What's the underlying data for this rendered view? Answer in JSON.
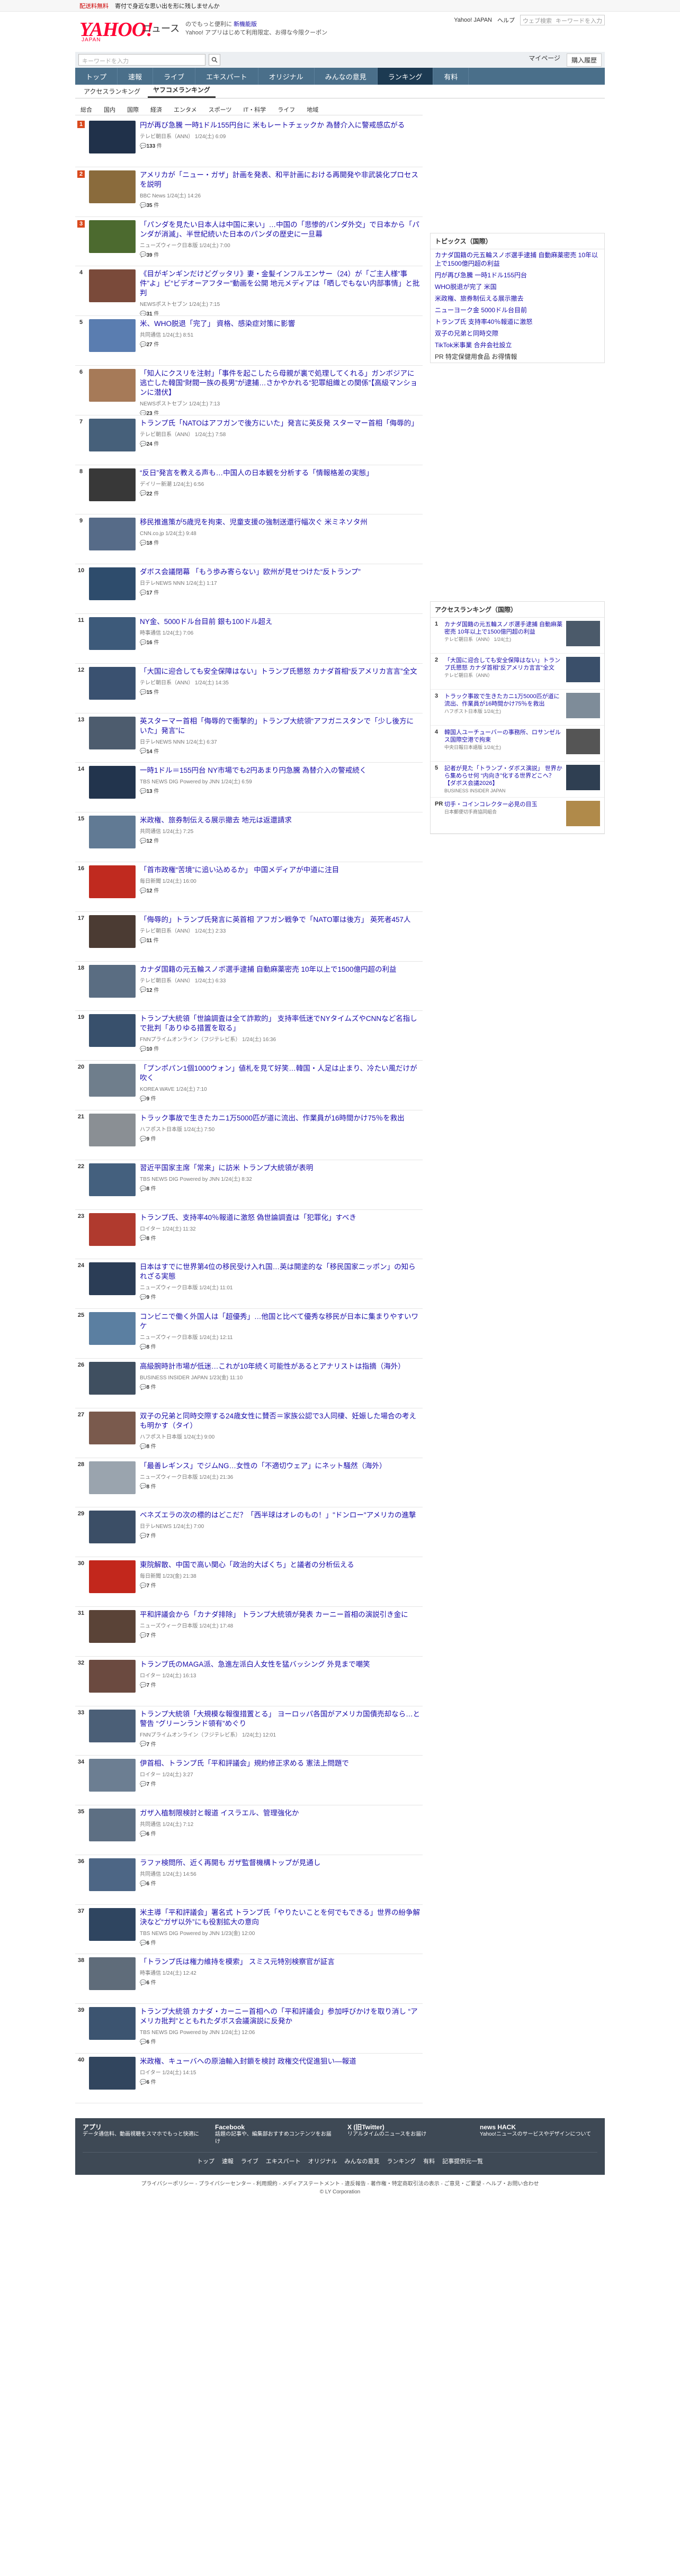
{
  "topbar": {
    "left": "配送料無料",
    "mid": "寄付で身近な思い出を形に残しませんか",
    "right": ""
  },
  "header": {
    "logo": "YAHOO!",
    "logo_sub": "JAPAN",
    "service": "ニュース",
    "tag1": "のでもっと便利に",
    "tag1b": "新機能版",
    "tag2": "Yahoo! アプリはじめて利用限定、お得な今限クーポン",
    "links": [
      "Yahoo! JAPAN",
      "ヘルプ"
    ],
    "search_placeholder": "ウェブ検索",
    "search_tag": "キーワードを入力"
  },
  "searchrow": {
    "placeholder": "キーワードを入力",
    "mypage": "マイページ",
    "buy": "購入履歴"
  },
  "gnav": [
    "トップ",
    "速報",
    "ライブ",
    "エキスパート",
    "オリジナル",
    "みんなの意見",
    "ランキング",
    "有料"
  ],
  "subtabs": [
    "アクセスランキング",
    "ヤフコメランキング"
  ],
  "cats": [
    "総合",
    "国内",
    "国際",
    "経済",
    "エンタメ",
    "スポーツ",
    "IT・科学",
    "ライフ",
    "地域"
  ],
  "items": [
    {
      "rank": "1",
      "title": "円が再び急騰 一時1ドル155円台に 米もレートチェックか 為替介入に警戒感広がる",
      "src": "テレビ朝日系（ANN） 1/24(土) 6:09",
      "cmt": "133",
      "color": "#20314a"
    },
    {
      "rank": "2",
      "title": "アメリカが「ニュー・ガザ」計画を発表、和平計画における再開発や非武装化プロセスを説明",
      "src": "BBC News 1/24(土) 14:26",
      "cmt": "35",
      "color": "#8a6b3c"
    },
    {
      "rank": "3",
      "title": "「パンダを見たい日本人は中国に来い」…中国の「悲惨的パンダ外交」で日本から「パンダが消滅」、半世紀続いた日本のパンダの歴史に一旦幕",
      "src": "ニューズウィーク日本版 1/24(土) 7:00",
      "cmt": "39",
      "color": "#4c6a2f"
    },
    {
      "rank": "4",
      "title": "《目がギンギンだけどグッタリ》妻・金髪インフルエンサー（24）が「ご主人様”事件”よ」ビ“ビデオーアフター”動画を公開 地元メディアは「晒しでもない内部事情」と批判",
      "src": "NEWSポストセブン 1/24(土) 7:15",
      "cmt": "31",
      "color": "#7a4a3a"
    },
    {
      "rank": "5",
      "title": "米、WHO脱退「完了」 資格、感染症対策に影響",
      "src": "共同通信 1/24(土) 8:51",
      "cmt": "27",
      "color": "#5a7db0"
    },
    {
      "rank": "6",
      "title": "「知人にクスリを注射」「事件を起こしたら母親が裏で処理してくれる」ガンボジアに逃亡した韓国“財閥一族の長男”が逮捕…さかやかれる“犯罪組織との関係”【高級マンションに潜伏】",
      "src": "NEWSポストセブン 1/24(土) 7:13",
      "cmt": "23",
      "color": "#a67a58"
    },
    {
      "rank": "7",
      "title": "トランプ氏「NATOはアフガンで後方にいた」発言に英反発 スターマー首相「侮辱的」",
      "src": "テレビ朝日系（ANN） 1/24(土) 7:58",
      "cmt": "24",
      "color": "#46607a"
    },
    {
      "rank": "8",
      "title": "“反日”発言を教える声も…中国人の日本観を分析する「情報格差の実態」",
      "src": "デイリー新潮 1/24(土) 6:56",
      "cmt": "22",
      "color": "#383838"
    },
    {
      "rank": "9",
      "title": "移民推進策が5歳児を拘束、児童支援の強制送還行幅次ぐ 米ミネソタ州",
      "src": "CNN.co.jp 1/24(土) 9:48",
      "cmt": "18",
      "color": "#566b88"
    },
    {
      "rank": "10",
      "title": "ダボス会議閉幕 「もう歩み寄らない」欧州が見せつけた“反トランプ”",
      "src": "日テレNEWS NNN 1/24(土) 1:17",
      "cmt": "17",
      "color": "#2e4c6c"
    },
    {
      "rank": "11",
      "title": "NY金、5000ドル台目前 銀も100ドル超え",
      "src": "時事通信 1/24(土) 7:06",
      "cmt": "16",
      "color": "#3d5a7a"
    },
    {
      "rank": "12",
      "title": "「大国に迎合しても安全保障はない」トランプ氏懇怒 カナダ首相“反アメリカ言言”全文",
      "src": "テレビ朝日系（ANN） 1/24(土) 14:35",
      "cmt": "15",
      "color": "#3a5170"
    },
    {
      "rank": "13",
      "title": "英スターマー首相「侮辱的で衝撃的」トランプ大統領“アフガニスタンで「少し後方にいた」発言”に",
      "src": "日テレNEWS NNN 1/24(土) 6:37",
      "cmt": "14",
      "color": "#4d5c6e"
    },
    {
      "rank": "14",
      "title": "一時1ドル＝155円台 NY市場でも2円あまり円急騰 為替介入の警戒続く",
      "src": "TBS NEWS DIG Powered by JNN 1/24(土) 6:59",
      "cmt": "13",
      "color": "#22344d"
    },
    {
      "rank": "15",
      "title": "米政権、旅券制伝える展示撤去 地元は返還請求",
      "src": "共同通信 1/24(土) 7:25",
      "cmt": "12",
      "color": "#617a94"
    },
    {
      "rank": "16",
      "title": "「首市政権“苦境”に追い込めるか」 中国メディアが中道に注目",
      "src": "毎日新聞 1/24(土) 16:00",
      "cmt": "12",
      "color": "#c02a1f"
    },
    {
      "rank": "17",
      "title": "「侮辱的」トランプ氏発言に英首相 アフガン戦争で「NATO軍は後方」 英死者457人",
      "src": "テレビ朝日系（ANN） 1/24(土) 2:33",
      "cmt": "11",
      "color": "#4b3b33"
    },
    {
      "rank": "18",
      "title": "カナダ国籍の元五輪スノボ選手逮捕 自動麻薬密売 10年以上で1500億円超の利益",
      "src": "テレビ朝日系（ANN） 1/24(土) 6:33",
      "cmt": "12",
      "color": "#5a6d82"
    },
    {
      "rank": "19",
      "title": "トランプ大統領「世論調査は全て詐欺的」 支持率低迷でNYタイムズやCNNなど名指しで批判「ありゆる措置を取る」",
      "src": "FNNプライムオンライン（フジテレビ系） 1/24(土) 16:36",
      "cmt": "10",
      "color": "#38506c"
    },
    {
      "rank": "20",
      "title": "「プンポパン1個1000ウォン」値札を見て好笑…韓国・人足は止まり、冷たい風だけが吹く",
      "src": "KOREA WAVE 1/24(土) 7:10",
      "cmt": "9",
      "color": "#6f7e8c"
    },
    {
      "rank": "21",
      "title": "トラック事故で生きたカニ1万5000匹が道に流出、作業員が16時間かけ75％を救出",
      "src": "ハフポスト日本版 1/24(土) 7:50",
      "cmt": "9",
      "color": "#8a8f94"
    },
    {
      "rank": "22",
      "title": "習近平国家主席「常来」に訪米 トランプ大統領が表明",
      "src": "TBS NEWS DIG Powered by JNN 1/24(土) 8:32",
      "cmt": "8",
      "color": "#44607e"
    },
    {
      "rank": "23",
      "title": "トランプ氏、支持率40％報道に激怒 偽世論調査は「犯罪化」すべき",
      "src": "ロイター 1/24(土) 11:32",
      "cmt": "8",
      "color": "#b03a2e"
    },
    {
      "rank": "24",
      "title": "日本はすでに世界第4位の移民受け入れ国…英は開塗的な「移民国家ニッポン」の知られざる実態",
      "src": "ニューズウィーク日本版 1/24(土) 11:01",
      "cmt": "9",
      "color": "#2b3d56"
    },
    {
      "rank": "25",
      "title": "コンビニで働く外国人は「超優秀」…他国と比べて優秀な移民が日本に集まりやすいワケ",
      "src": "ニューズウィーク日本版 1/24(土) 12:11",
      "cmt": "8",
      "color": "#5b7fa1"
    },
    {
      "rank": "26",
      "title": "高級腕時計市場が低迷…これが10年続く可能性があるとアナリストは指摘（海外）",
      "src": "BUSINESS INSIDER JAPAN 1/23(金) 11:10",
      "cmt": "8",
      "color": "#3f4f60"
    },
    {
      "rank": "27",
      "title": "双子の兄弟と同時交際する24歳女性に賛否＝家族公認で3人同棲、妊娠した場合の考えも明かす（タイ）",
      "src": "ハフポスト日本版 1/24(土) 9:00",
      "cmt": "8",
      "color": "#7a5a4d"
    },
    {
      "rank": "28",
      "title": "「最善レギンス」でジムNG…女性の「不適切ウェア」にネット騒然（海外）",
      "src": "ニューズウィーク日本版 1/24(土) 21:36",
      "cmt": "8",
      "color": "#9aa4ae"
    },
    {
      "rank": "29",
      "title": "ベネズエラの次の標的はどこだ？「西半球はオレのもの！」\"ドンロー\"アメリカの進撃",
      "src": "日テレNEWS 1/24(土) 7:00",
      "cmt": "7",
      "color": "#3b4e66"
    },
    {
      "rank": "30",
      "title": "東院解散、中国で高い関心「政治的大ばくち」と議者の分析伝える",
      "src": "毎日新聞 1/23(金) 21:38",
      "cmt": "7",
      "color": "#c2271c"
    },
    {
      "rank": "31",
      "title": "平和評議会から「カナダ排除」 トランプ大統領が発表 カーニー首相の演説引き金に",
      "src": "ニューズウィーク日本版 1/24(土) 17:48",
      "cmt": "7",
      "color": "#5a4337"
    },
    {
      "rank": "32",
      "title": "トランプ氏のMAGA派、急進左派白人女性を猛バッシング 外見まで嘲笑",
      "src": "ロイター 1/24(土) 16:13",
      "cmt": "7",
      "color": "#6b4a40"
    },
    {
      "rank": "33",
      "title": "トランプ大統領「大規模な報復措置とる」 ヨーロッパ各国がアメリカ国債売却なら…と警告 “グリーンランド領有”めぐり",
      "src": "FNNプライムオンライン（フジテレビ系） 1/24(土) 12:01",
      "cmt": "7",
      "color": "#4b5f77"
    },
    {
      "rank": "34",
      "title": "伊首相、トランプ氏「平和評議会」規約修正求める 憲法上問題で",
      "src": "ロイター 1/24(土) 3:27",
      "cmt": "7",
      "color": "#6c7e92"
    },
    {
      "rank": "35",
      "title": "ガザ入植制限検討と報道 イスラエル、管理強化か",
      "src": "共同通信 1/24(土) 7:12",
      "cmt": "6",
      "color": "#5d6f83"
    },
    {
      "rank": "36",
      "title": "ラファ検問所、近く再開も ガザ監督機構トップが見通し",
      "src": "共同通信 1/24(土) 14:56",
      "cmt": "6",
      "color": "#4d6685"
    },
    {
      "rank": "37",
      "title": "米主導「平和評議会」署名式 トランプ氏「やりたいことを何でもできる」世界の紛争解決など“ガザ以外”にも役割拡大の意向",
      "src": "TBS NEWS DIG Powered by JNN 1/23(金) 12:00",
      "cmt": "6",
      "color": "#2f4560"
    },
    {
      "rank": "38",
      "title": "「トランプ氏は権力維持を模索」 スミス元特別検察官が証言",
      "src": "時事通信 1/24(土) 12:42",
      "cmt": "6",
      "color": "#5f6c7a"
    },
    {
      "rank": "39",
      "title": "トランプ大統領 カナダ・カーニー首相への「平和評議会」参加呼びかけを取り消し “アメリカ批判”とともれたダボス会議演説に反発か",
      "src": "TBS NEWS DIG Powered by JNN 1/24(土) 12:06",
      "cmt": "6",
      "color": "#3c5470"
    },
    {
      "rank": "40",
      "title": "米政権、キューバへの原油輸入封鎖を検討 政権交代促進狙い―報道",
      "src": "ロイター 1/24(土) 14:15",
      "cmt": "6",
      "color": "#31455e"
    }
  ],
  "topics": {
    "heading": "トピックス（国際）",
    "items": [
      "カナダ国籍の元五輪スノボ選手逮捕 自動麻薬密売 10年以上で1500億円超の利益",
      "円が再び急騰 一時1ドル155円台",
      "WHO脱退が完了 米国",
      "米政権、旅券制伝える展示撤去",
      "ニューヨーク金 5000ドル台目前",
      "トランプ氏 支持率40％報道に激怒",
      "双子の兄弟と同時交際",
      "TikTok米事業 合弁会社設立"
    ],
    "pr": "PR 特定保健用食品 お得情報"
  },
  "access": {
    "heading": "アクセスランキング（国際）",
    "items": [
      {
        "n": "1",
        "t": "カナダ国籍の元五輪スノボ選手逮捕 自動麻薬密売 10年以上で1500億円超の利益",
        "s": "テレビ朝日系（ANN） 1/24(土)",
        "color": "#4b5a6a"
      },
      {
        "n": "2",
        "t": "「大国に迎合しても安全保障はない」トランプ氏懇怒 カナダ首相“反アメリカ言言”全文",
        "s": "テレビ朝日系（ANN）",
        "color": "#3a4f6a"
      },
      {
        "n": "3",
        "t": "トラック事故で生きたカニ1万5000匹が道に流出、作業員が16時間かけ75％を救出",
        "s": "ハフポスト日本版 1/24(土)",
        "color": "#7e8c99"
      },
      {
        "n": "4",
        "t": "韓国人ユーチューバーの事務所、ロサンゼルス国際空港で拘束",
        "s": "中央日報日本語版 1/24(土)",
        "color": "#555"
      },
      {
        "n": "5",
        "t": "記者が見た「トランプ・ダボス演説」 世界から集めらせ何 “内向き”化する世界どこへ？【ダボス会議2026】",
        "s": "BUSINESS INSIDER JAPAN",
        "color": "#2f3f52"
      },
      {
        "n": "PR",
        "t": "切手・コインコレクター必見の目玉",
        "s": "日本郵便切手商協同組合",
        "color": "#b08a4a"
      }
    ]
  },
  "footer": {
    "apps": [
      {
        "t": "アプリ",
        "d": "データ通信料、動画視聴をスマホでもっと快適に"
      },
      {
        "t": "Facebook",
        "d": "話題の記事や、編集部おすすめコンテンツをお届け"
      },
      {
        "t": "X (旧Twitter)",
        "d": "リアルタイムのニュースをお届け"
      },
      {
        "t": "news HACK",
        "d": "Yahoo!ニュースのサービスやデザインについて"
      }
    ],
    "links": [
      "トップ",
      "速報",
      "ライブ",
      "エキスパート",
      "オリジナル",
      "みんなの意見",
      "ランキング",
      "有料",
      "記事提供元一覧"
    ],
    "bottom": "プライバシーポリシー - プライバシーセンター - 利用規約 - メディアステートメント - 違反報告 - 著作権・特定商取引法の表示 - ご意見・ご要望 - ヘルプ・お問い合わせ",
    "copy": "© LY Corporation"
  }
}
